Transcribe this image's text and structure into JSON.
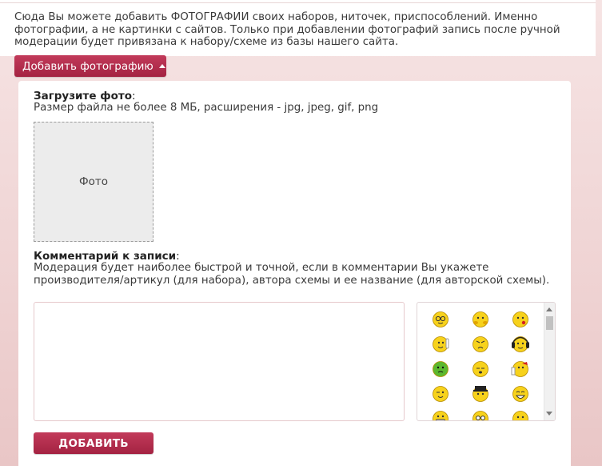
{
  "intro": {
    "text": "Сюда Вы можете добавить ФОТОГРАФИИ своих наборов, ниточек, приспособлений. Именно фотографии, а не картинки с сайтов. Только при добавлении фотографий запись после ручной модерации будет привязана к набору/схеме из базы нашего сайта."
  },
  "toggle_button": {
    "label": "Добавить фотографию"
  },
  "upload": {
    "title": "Загрузите фото",
    "title_colon": ":",
    "hint": "Размер файла не более 8 МБ, расширения - jpg, jpeg, gif, png",
    "photo_placeholder": "Фото"
  },
  "comment": {
    "title": "Комментарий к записи",
    "title_colon": ":",
    "hint": "Модерация будет наиболее быстрой и точной, если в комментарии Вы укажете производителя/артикул (для набора), автора схемы и ее название (для авторской схемы).",
    "value": ""
  },
  "smileys": [
    "nerd-smiley-icon",
    "shy-smiley-icon",
    "kiss-smiley-icon",
    "wave-smiley-icon",
    "angry-smiley-icon",
    "headphones-smiley-icon",
    "sick-smiley-icon",
    "sleepy-smiley-icon",
    "drinking-smiley-icon",
    "wink-smiley-icon",
    "detective-smiley-icon",
    "laugh-smiley-icon",
    "grin-smiley-icon",
    "surprised-smiley-icon",
    "tongue-smiley-icon"
  ],
  "submit_button": {
    "label": "ДОБАВИТЬ"
  },
  "colors": {
    "accent": "#b02d4d",
    "background": "#f3dcdc",
    "panel": "#ffffff",
    "input_border": "#e6c9cc"
  }
}
